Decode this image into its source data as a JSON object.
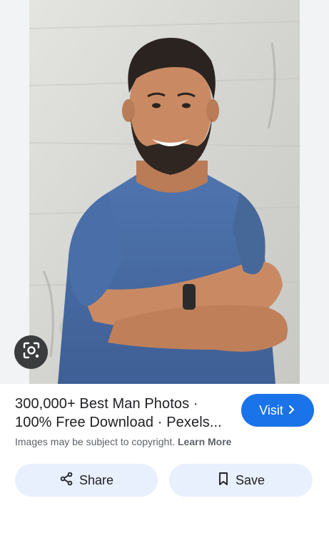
{
  "image": {
    "alt": "Smiling bearded man in a blue t-shirt with arms crossed",
    "colors": {
      "shirt": "#4a6ea7",
      "skin": "#c98a63",
      "wall": "#d9d9d6",
      "hair": "#2a2320"
    }
  },
  "lens": {
    "icon": "google-lens-icon"
  },
  "result": {
    "title_line1": "300,000+ Best Man Photos ·",
    "title_line2": "100% Free Download · Pexels...",
    "visit_label": "Visit",
    "copyright_text": "Images may be subject to copyright.",
    "learn_more_label": "Learn More"
  },
  "actions": {
    "share_label": "Share",
    "save_label": "Save"
  },
  "colors": {
    "accent": "#1a73e8",
    "button_tint": "#e8f0fe",
    "text": "#202124",
    "muted": "#5f6368"
  }
}
